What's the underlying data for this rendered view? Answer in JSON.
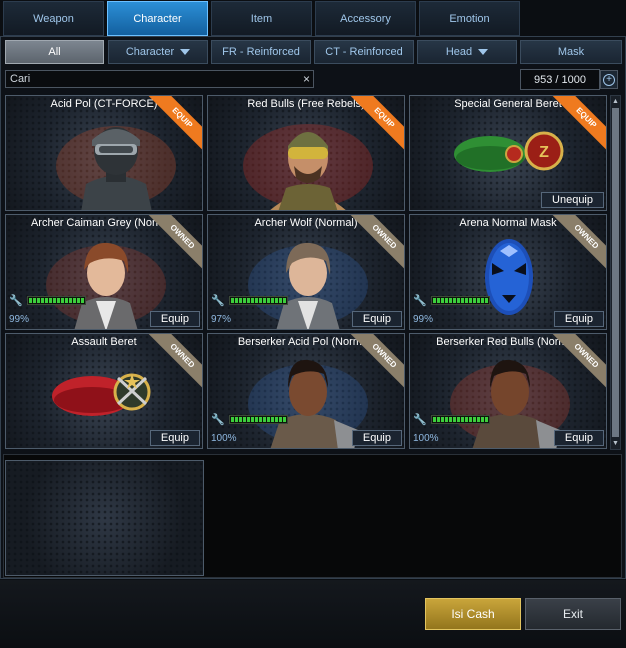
{
  "top_tabs": [
    {
      "label": "Weapon"
    },
    {
      "label": "Character"
    },
    {
      "label": "Item"
    },
    {
      "label": "Accessory"
    },
    {
      "label": "Emotion"
    }
  ],
  "filters": [
    {
      "label": "All"
    },
    {
      "label": "Character"
    },
    {
      "label": "FR - Reinforced"
    },
    {
      "label": "CT - Reinforced"
    },
    {
      "label": "Head"
    },
    {
      "label": "Mask"
    }
  ],
  "search": {
    "value": "Cari",
    "clear_icon": "×"
  },
  "inventory_count": "953 / 1000",
  "cards": [
    {
      "title": "Acid Pol (CT-FORCE)",
      "ribbon": "EQUIP",
      "durability": null,
      "action": null
    },
    {
      "title": "Red Bulls (Free Rebels)",
      "ribbon": "EQUIP",
      "durability": null,
      "action": null
    },
    {
      "title": "Special General Beret",
      "ribbon": "EQUIP",
      "durability": null,
      "action": "Unequip"
    },
    {
      "title": "Archer Caiman Grey (Normal)",
      "ribbon": "OWNED",
      "durability": "99%",
      "action": "Equip"
    },
    {
      "title": "Archer Wolf (Normal)",
      "ribbon": "OWNED",
      "durability": "97%",
      "action": "Equip"
    },
    {
      "title": "Arena Normal Mask",
      "ribbon": "OWNED",
      "durability": "99%",
      "action": "Equip"
    },
    {
      "title": "Assault Beret",
      "ribbon": "OWNED",
      "durability": null,
      "action": "Equip"
    },
    {
      "title": "Berserker Acid Pol (Normal)",
      "ribbon": "OWNED",
      "durability": "100%",
      "action": "Equip"
    },
    {
      "title": "Berserker Red Bulls (Normal)",
      "ribbon": "OWNED",
      "durability": "100%",
      "action": "Equip"
    }
  ],
  "buttons": {
    "cash": "Isi Cash",
    "exit": "Exit"
  },
  "colors": {
    "accent": "#2c8fd6",
    "equip_ribbon": "#ef7a1f",
    "owned_ribbon": "#8b7f6a",
    "cash": "#c9a53b"
  }
}
